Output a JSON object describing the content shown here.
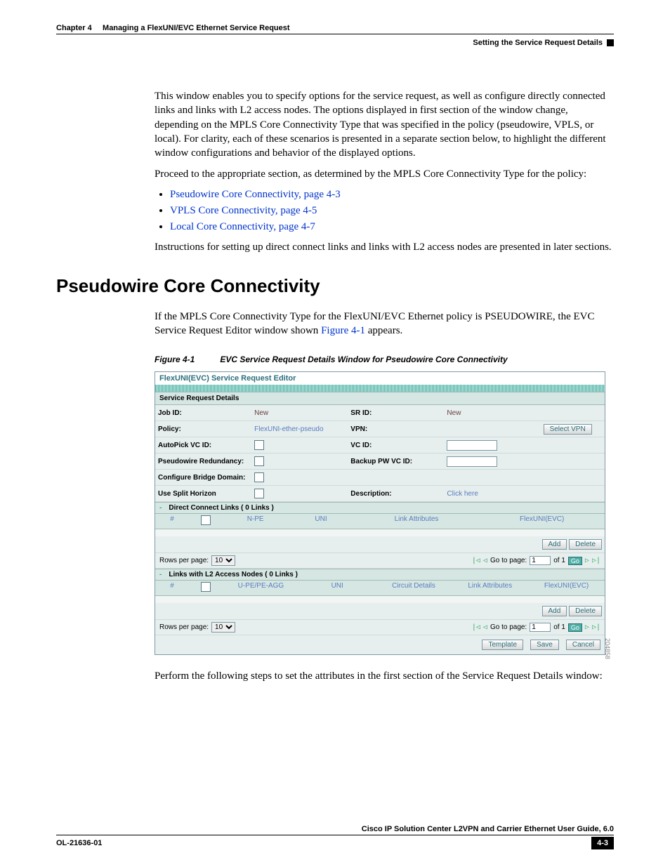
{
  "header": {
    "chapter": "Chapter 4",
    "title": "Managing a FlexUNI/EVC Ethernet Service Request",
    "section": "Setting the Service Request Details"
  },
  "intro": {
    "p1": "This window enables you to specify options for the service request, as well as configure directly connected links and links with L2 access nodes. The options displayed in first section of the window change, depending on the MPLS Core Connectivity Type that was specified in the policy (pseudowire, VPLS, or local). For clarity, each of these scenarios is presented in a separate section below, to highlight the different window configurations and behavior of the displayed options.",
    "p2": "Proceed to the appropriate section, as determined by the MPLS Core Connectivity Type for the policy:",
    "bullets": {
      "b1": "Pseudowire Core Connectivity, page 4-3",
      "b2": "VPLS Core Connectivity, page 4-5",
      "b3": "Local Core Connectivity, page 4-7"
    },
    "p3": "Instructions for setting up direct connect links and links with L2 access nodes are presented in later sections."
  },
  "h2": "Pseudowire Core Connectivity",
  "section_p1_a": "If the MPLS Core Connectivity Type for the FlexUNI/EVC Ethernet policy is PSEUDOWIRE, the EVC Service Request Editor window shown ",
  "section_p1_link": "Figure 4-1",
  "section_p1_b": " appears.",
  "figure": {
    "label": "Figure 4-1",
    "title": "EVC Service Request Details Window for Pseudowire Core Connectivity",
    "imgnum": "204858"
  },
  "editor": {
    "title": "FlexUNI(EVC) Service Request Editor",
    "srd": "Service Request Details",
    "rows": {
      "jobid": "Job ID:",
      "jobid_val": "New",
      "srid": "SR ID:",
      "srid_val": "New",
      "policy": "Policy:",
      "policy_val": "FlexUNI-ether-pseudo",
      "vpn": "VPN:",
      "selectvpn": "Select VPN",
      "autopick": "AutoPick VC ID:",
      "vcid": "VC ID:",
      "pwr": "Pseudowire Redundancy:",
      "backup": "Backup PW VC ID:",
      "cbd": "Configure Bridge Domain:",
      "ush": "Use Split Horizon",
      "desc": "Description:",
      "click": "Click here"
    },
    "direct": "Direct Connect Links  ( 0 Links )",
    "l2": "Links with L2 Access Nodes  ( 0 Links )",
    "cols1": {
      "c1": "#",
      "c2": "N-PE",
      "c3": "UNI",
      "c4": "Link Attributes",
      "c5": "FlexUNI(EVC)"
    },
    "cols2": {
      "c1": "#",
      "c2": "U-PE/PE-AGG",
      "c3": "UNI",
      "c4": "Circuit Details",
      "c5": "Link Attributes",
      "c6": "FlexUNI(EVC)"
    },
    "add": "Add",
    "delete": "Delete",
    "pager": {
      "rows": "Rows per page:",
      "val": "10",
      "goto": "Go to page:",
      "page": "1",
      "of": "of 1",
      "go": "Go"
    },
    "footer": {
      "template": "Template",
      "save": "Save",
      "cancel": "Cancel"
    }
  },
  "after_fig": "Perform the following steps to set the attributes in the first section of the Service Request Details window:",
  "pagefooter": {
    "doc": "Cisco IP Solution Center L2VPN and Carrier Ethernet User Guide, 6.0",
    "ol": "OL-21636-01",
    "page": "4-3"
  }
}
